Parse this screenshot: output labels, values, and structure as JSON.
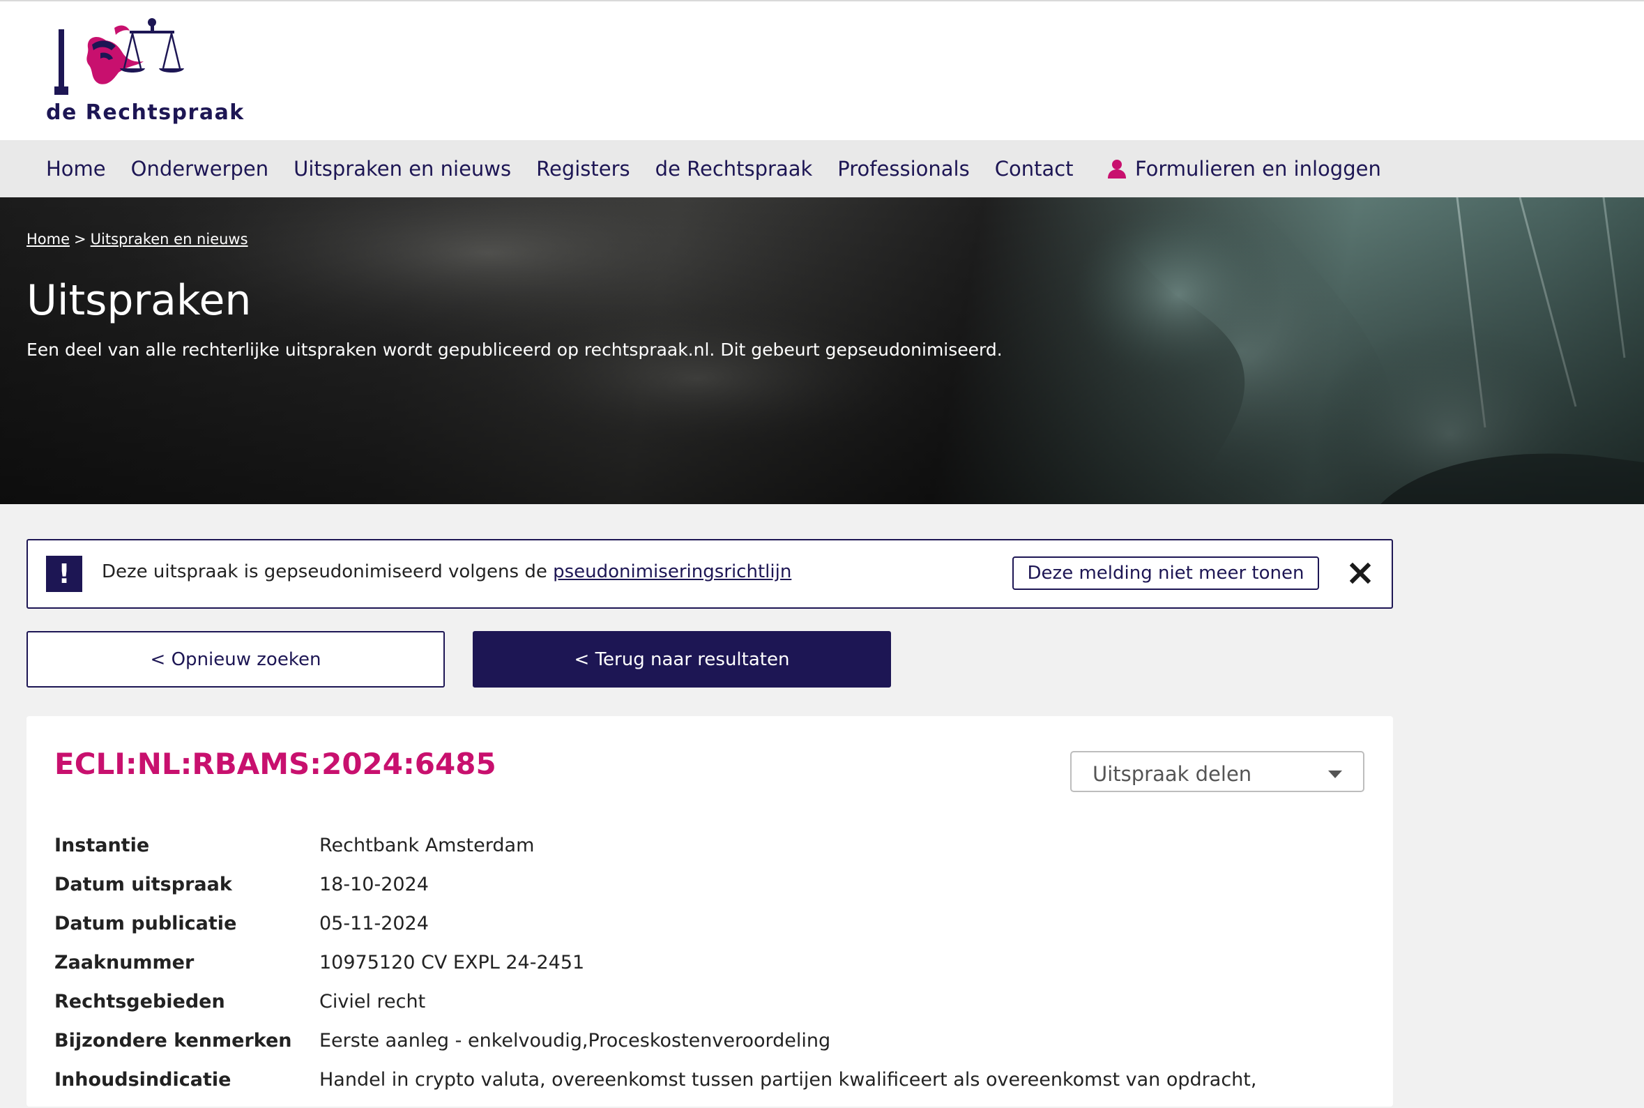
{
  "brand": {
    "name": "de Rechtspraak",
    "colors": {
      "primary": "#1d1654",
      "accent": "#c8106e"
    }
  },
  "nav": {
    "items": [
      {
        "label": "Home"
      },
      {
        "label": "Onderwerpen"
      },
      {
        "label": "Uitspraken en nieuws"
      },
      {
        "label": "Registers"
      },
      {
        "label": "de Rechtspraak"
      },
      {
        "label": "Professionals"
      },
      {
        "label": "Contact"
      }
    ],
    "login": {
      "label": "Formulieren en inloggen",
      "icon": "user-icon"
    }
  },
  "hero": {
    "breadcrumb": [
      {
        "label": "Home"
      },
      {
        "label": "Uitspraken en nieuws"
      }
    ],
    "breadcrumb_separator": ">",
    "title": "Uitspraken",
    "intro": "Een deel van alle rechterlijke uitspraken wordt gepubliceerd op rechtspraak.nl. Dit gebeurt gepseudonimiseerd."
  },
  "notice": {
    "icon": "exclamation-icon",
    "text": "Deze uitspraak is gepseudonimiseerd volgens de",
    "link": "pseudonimiseringsrichtlijn",
    "dismiss_label": "Deze melding niet meer tonen",
    "close_icon": "close-icon"
  },
  "actions": {
    "new_search": "< Opnieuw zoeken",
    "back_to_results": "< Terug naar resultaten"
  },
  "ruling": {
    "ecli": "ECLI:NL:RBAMS:2024:6485",
    "share_label": "Uitspraak delen",
    "fields": [
      {
        "label": "Instantie",
        "value": "Rechtbank Amsterdam"
      },
      {
        "label": "Datum uitspraak",
        "value": "18-10-2024"
      },
      {
        "label": "Datum publicatie",
        "value": "05-11-2024"
      },
      {
        "label": "Zaaknummer",
        "value": "10975120 CV EXPL 24-2451"
      },
      {
        "label": "Rechtsgebieden",
        "value": "Civiel recht"
      },
      {
        "label": "Bijzondere kenmerken",
        "value": "Eerste aanleg - enkelvoudig,Proceskostenveroordeling"
      },
      {
        "label": "Inhoudsindicatie",
        "value": "Handel in crypto valuta, overeenkomst tussen partijen kwalificeert als overeenkomst van opdracht,"
      }
    ]
  }
}
